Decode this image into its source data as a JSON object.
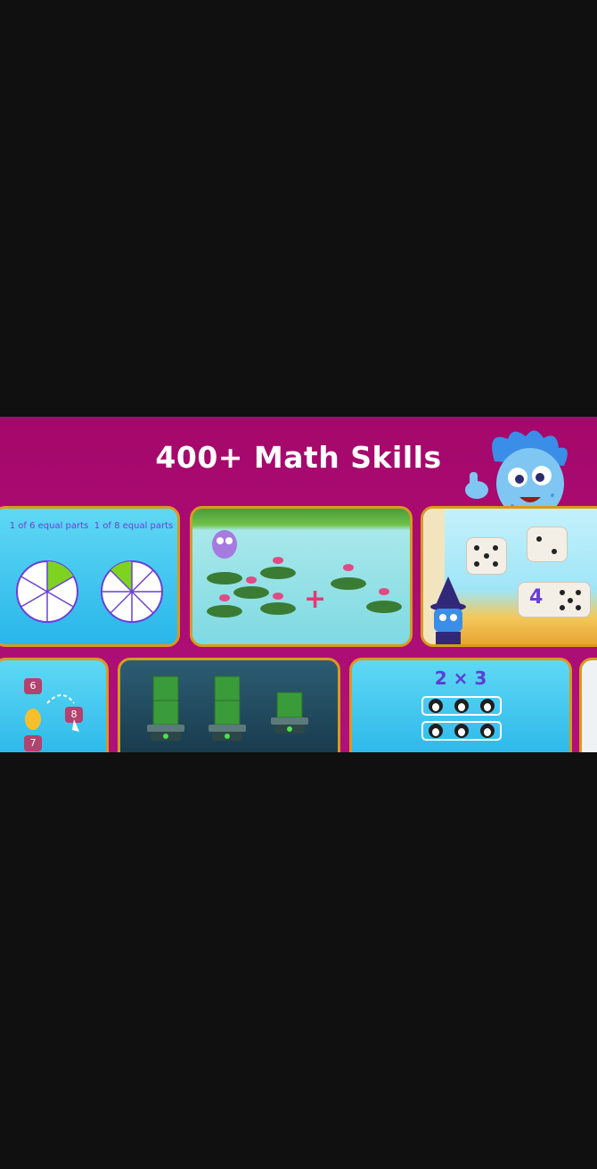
{
  "banner": {
    "title": "400+ Math Skills",
    "accent_color": "#a5086b",
    "card_border_color": "#d89a1e"
  },
  "cards": {
    "fractions": {
      "label_left": "1 of 6 equal parts",
      "label_right": "1 of 8 equal parts"
    },
    "pond": {
      "operator": "+"
    },
    "dice": {
      "number": "4"
    },
    "multiply": {
      "expression": "2 × 3"
    },
    "path": {
      "tile_top": "6",
      "tile_mid": "8",
      "tile_bottom": "7"
    }
  },
  "icons": [
    "mascot-icon",
    "wizard-icon",
    "penguin-icon",
    "mushroom-icon"
  ]
}
